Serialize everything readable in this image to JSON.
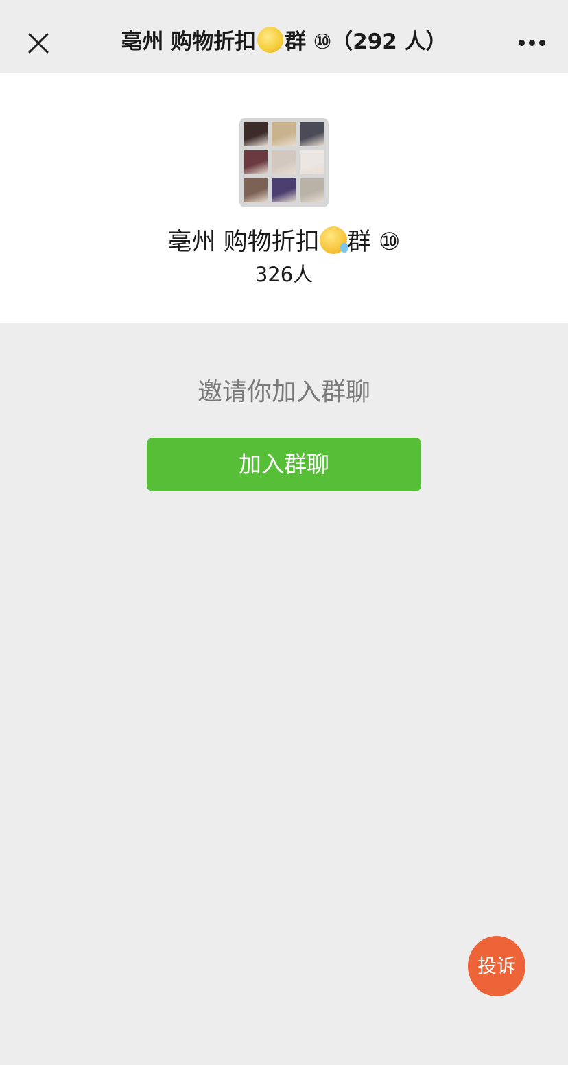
{
  "nav": {
    "title_prefix": "亳州 购物折扣",
    "title_emoji": "moon-emoji",
    "title_suffix": "群 ⑩（292 人）",
    "close_icon": "close-icon",
    "more_icon": "more-dots-icon"
  },
  "group": {
    "name_prefix": "亳州 购物折扣",
    "name_emoji": "sleepy-face-emoji",
    "name_suffix": "群 ⑩",
    "member_count": "326人",
    "avatar_colors": [
      "#3b2c2a",
      "#c9b38e",
      "#4a4b57",
      "#6a3a40",
      "#d2c8bf",
      "#ece6e2",
      "#7b6254",
      "#4b3f70",
      "#b9b2a6"
    ]
  },
  "invite": {
    "text": "邀请你加入群聊",
    "join_label": "加入群聊"
  },
  "complain": {
    "label": "投诉"
  },
  "colors": {
    "accent_green": "#57be38",
    "complain_orange": "#ee6439",
    "background": "#ededed"
  }
}
